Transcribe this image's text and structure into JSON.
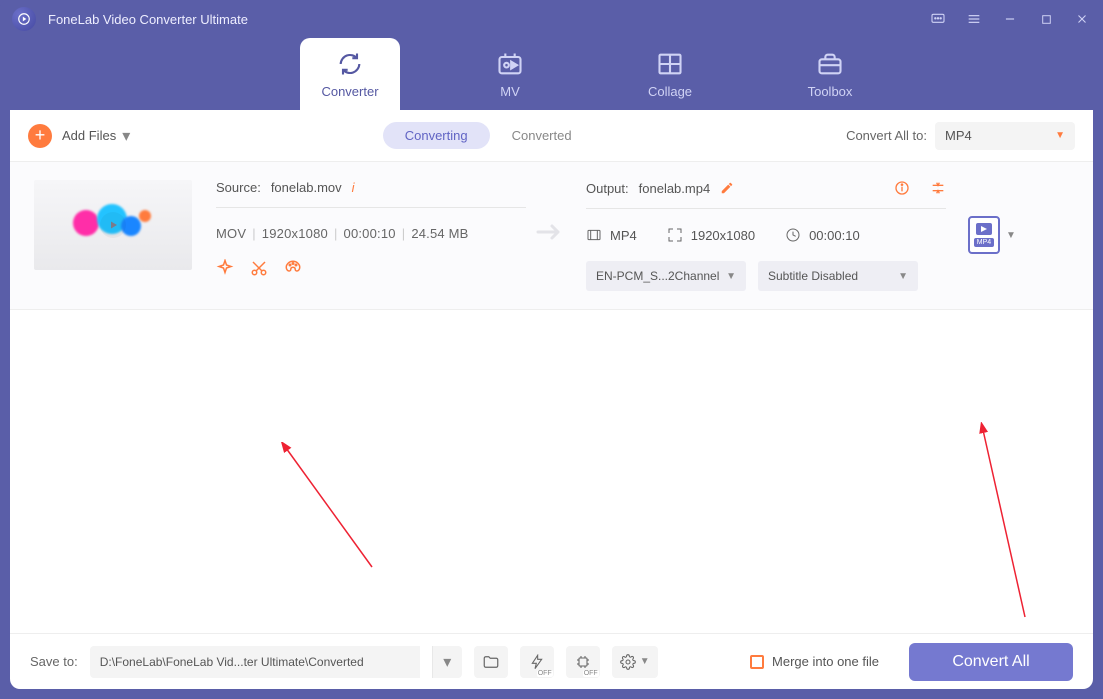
{
  "window": {
    "title": "FoneLab Video Converter Ultimate"
  },
  "tabs": [
    {
      "id": "converter",
      "label": "Converter"
    },
    {
      "id": "mv",
      "label": "MV"
    },
    {
      "id": "collage",
      "label": "Collage"
    },
    {
      "id": "toolbox",
      "label": "Toolbox"
    }
  ],
  "toolbar": {
    "add_files": "Add Files",
    "subtabs": {
      "converting": "Converting",
      "converted": "Converted"
    },
    "convert_all_label": "Convert All to:",
    "convert_all_value": "MP4"
  },
  "item": {
    "source": {
      "label": "Source:",
      "filename": "fonelab.mov",
      "container": "MOV",
      "resolution": "1920x1080",
      "duration": "00:00:10",
      "size": "24.54 MB"
    },
    "output": {
      "label": "Output:",
      "filename": "fonelab.mp4",
      "container": "MP4",
      "resolution": "1920x1080",
      "duration": "00:00:10",
      "audio": "EN-PCM_S...2Channel",
      "subtitle": "Subtitle Disabled",
      "format_badge": "MP4"
    }
  },
  "footer": {
    "save_to_label": "Save to:",
    "save_to_path": "D:\\FoneLab\\FoneLab Vid...ter Ultimate\\Converted",
    "merge_label": "Merge into one file",
    "convert_button": "Convert All",
    "off": "OFF"
  }
}
